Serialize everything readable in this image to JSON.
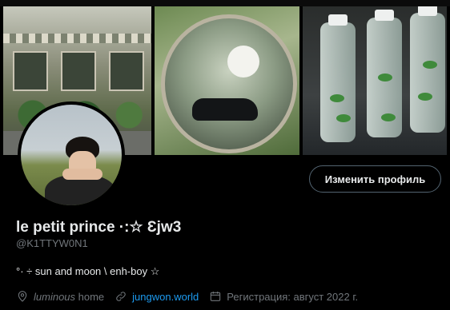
{
  "banner": {
    "top_strip_text": "• • •  • • •"
  },
  "profile": {
    "edit_button": "Изменить профиль",
    "display_name": "le petit prince ·:☆ Ɛjw3",
    "handle": "@K1TTYW0N1",
    "bio": "°· ÷ sun and moon \\ enh-boy ☆",
    "location_italic": "luminous",
    "location_rest": " home",
    "website": "jungwon.world",
    "joined": "Регистрация: август 2022 г."
  },
  "icons": {
    "location": "location-pin-icon",
    "link": "link-icon",
    "calendar": "calendar-icon"
  },
  "colors": {
    "background": "#000000",
    "text_primary": "#e7e9ea",
    "text_secondary": "#71767b",
    "link": "#1d9bf0",
    "button_border": "#536471"
  }
}
